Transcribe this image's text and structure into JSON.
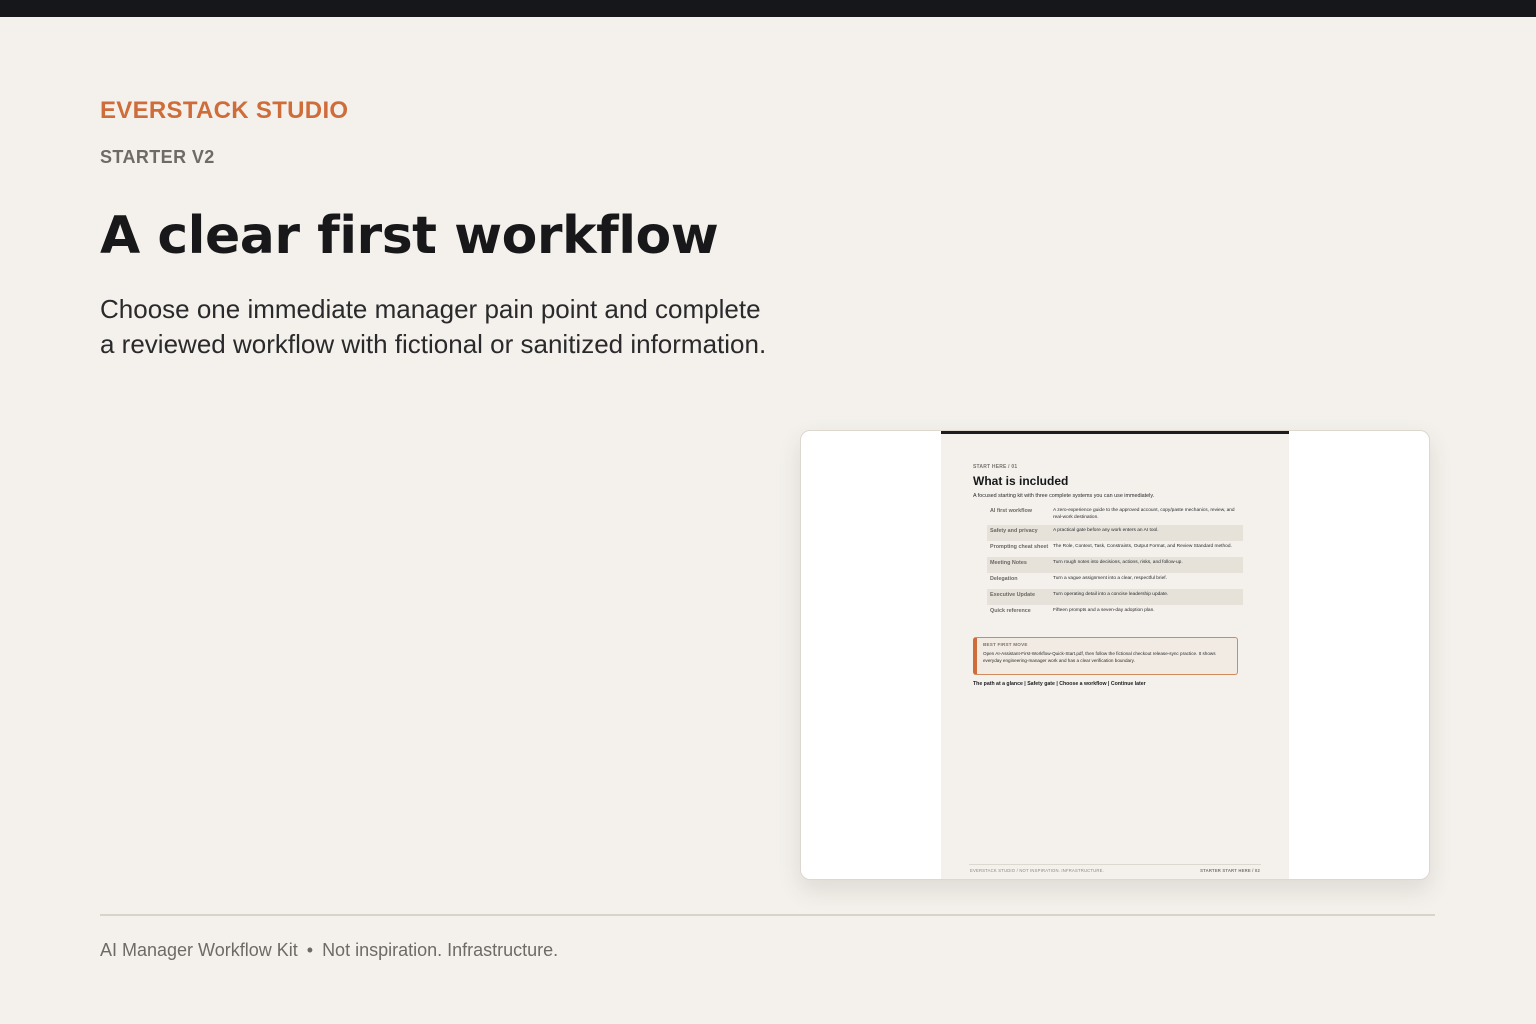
{
  "brand": "EVERSTACK STUDIO",
  "subbrand": "STARTER V2",
  "headline": "A clear first workflow",
  "lede_line1": "Choose one immediate manager pain point and complete",
  "lede_line2": "a reviewed workflow with fictional or sanitized information.",
  "preview": {
    "kicker": "START HERE / 01",
    "title": "What is included",
    "subtitle": "A focused starting kit with three complete systems you can use immediately.",
    "rows": [
      {
        "label": "AI first workflow",
        "desc": "A zero-experience guide to the approved account, copy/paste mechanics, review, and real-work destination."
      },
      {
        "label": "Safety and privacy",
        "desc": "A practical gate before any work enters an AI tool."
      },
      {
        "label": "Prompting cheat sheet",
        "desc": "The Role, Context, Task, Constraints, Output Format, and Review Standard method."
      },
      {
        "label": "Meeting Notes",
        "desc": "Turn rough notes into decisions, actions, risks, and follow-up."
      },
      {
        "label": "Delegation",
        "desc": "Turn a vague assignment into a clear, respectful brief."
      },
      {
        "label": "Executive Update",
        "desc": "Turn operating detail into a concise leadership update."
      },
      {
        "label": "Quick reference",
        "desc": "Fifteen prompts and a seven-day adoption plan."
      }
    ],
    "callout_label": "BEST FIRST MOVE",
    "callout_text": "Open AI-Assistant-First-Workflow-Quick-Start.pdf, then follow the fictional checkout release-sync practice. It shows everyday engineering-manager work and has a clear verification boundary.",
    "links": "The path at a glance | Safety gate | Choose a workflow | Continue later",
    "footer_left": "EVERSTACK STUDIO  /  NOT INSPIRATION. INFRASTRUCTURE.",
    "footer_right": "STARTER START HERE  /  02"
  },
  "footer": {
    "product": "AI Manager Workflow Kit",
    "separator": "•",
    "tagline": "Not inspiration. Infrastructure."
  }
}
